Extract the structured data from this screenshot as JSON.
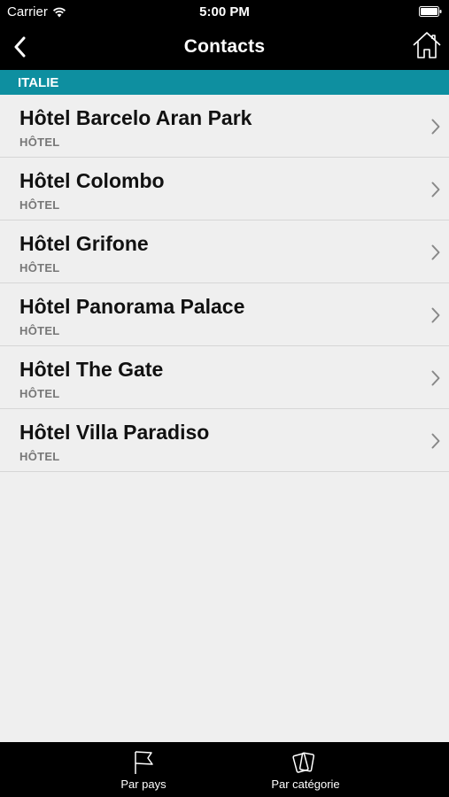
{
  "status_bar": {
    "carrier": "Carrier",
    "time": "5:00 PM"
  },
  "nav": {
    "title": "Contacts",
    "back_icon": "chevron-left-icon",
    "home_icon": "home-icon"
  },
  "section": {
    "title": "ITALIE",
    "color": "#0e8fa0"
  },
  "contacts": [
    {
      "name": "Hôtel Barcelo Aran Park",
      "category": "HÔTEL"
    },
    {
      "name": "Hôtel Colombo",
      "category": "HÔTEL"
    },
    {
      "name": "Hôtel Grifone",
      "category": "HÔTEL"
    },
    {
      "name": "Hôtel Panorama Palace",
      "category": "HÔTEL"
    },
    {
      "name": "Hôtel The Gate",
      "category": "HÔTEL"
    },
    {
      "name": "Hôtel Villa Paradiso",
      "category": "HÔTEL"
    }
  ],
  "tab_bar": {
    "tabs": [
      {
        "label": "Par pays",
        "icon": "flag-icon"
      },
      {
        "label": "Par catégorie",
        "icon": "cards-icon"
      }
    ]
  }
}
